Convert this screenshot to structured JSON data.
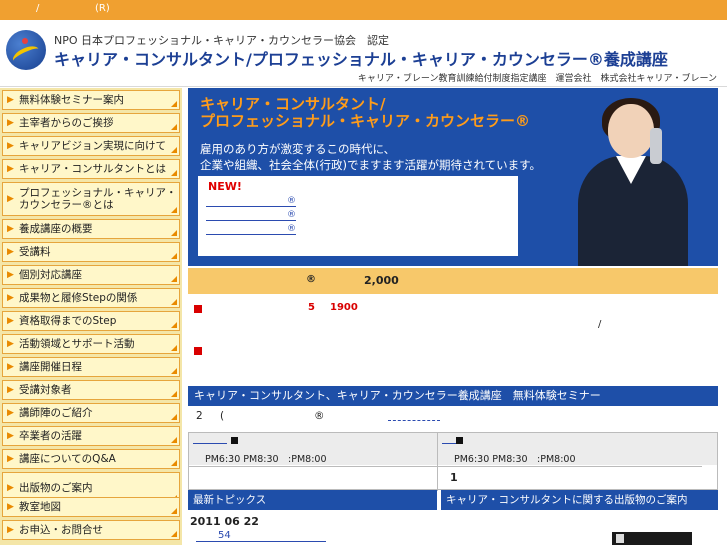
{
  "topbar": {
    "item1": "/",
    "item2": "(R)"
  },
  "header": {
    "assoc": "NPO 日本プロフェッショナル・キャリア・カウンセラー協会　認定",
    "title": "キャリア・コンサルタント/プロフェッショナル・キャリア・カウンセラー®養成講座",
    "provider": "キャリア・ブレーン教育訓練給付制度指定講座　運営会社　株式会社キャリア・ブレーン"
  },
  "sidebar": {
    "items": [
      {
        "label": "無料体験セミナー案内"
      },
      {
        "label": "主宰者からのご挨拶"
      },
      {
        "label": "キャリアビジョン実現に向けて"
      },
      {
        "label": "キャリア・コンサルタントとは"
      },
      {
        "label": "プロフェッショナル・キャリア・\nカウンセラー®とは"
      },
      {
        "label": "養成講座の概要"
      },
      {
        "label": "受講料"
      },
      {
        "label": "個別対応講座"
      },
      {
        "label": "成果物と履修Stepの関係"
      },
      {
        "label": "資格取得までのStep"
      },
      {
        "label": "活動領域とサポート活動"
      },
      {
        "label": "講座開催日程"
      },
      {
        "label": "受講対象者"
      },
      {
        "label": "講師陣のご紹介"
      },
      {
        "label": "卒業者の活躍"
      },
      {
        "label": "講座についてのQ&A"
      },
      {
        "label": "出版物のご案内"
      },
      {
        "label": "教室地図"
      },
      {
        "label": "お申込・お問合せ"
      }
    ]
  },
  "hero": {
    "title_line1": "キャリア・コンサルタント/",
    "title_line2": "プロフェッショナル・キャリア・カウンセラー®",
    "sub_line1": "雇用のあり方が激変するこの時代に、",
    "sub_line2": "企業や組織、社会全体(行政)でますます活躍が期待されています。",
    "new_badge": "NEW!",
    "links": [
      "®",
      "®",
      "®"
    ]
  },
  "price_band": {
    "mark": "®",
    "amount": "2,000"
  },
  "notice": {
    "num5": "5",
    "num1900": "1900",
    "slash": "/"
  },
  "seminar": {
    "bar_title": "キャリア・コンサルタント、キャリア・カウンセラー養成講座　無料体験セミナー",
    "count": "2",
    "paren": "(",
    "mark": "®"
  },
  "schedule": {
    "left_time": "PM6:30 PM8:30　:PM8:00",
    "right_time": "PM6:30 PM8:30　:PM8:00",
    "right_count": "1"
  },
  "topics": {
    "bar_title": "最新トピックス",
    "date": "2011 06 22",
    "link": "54"
  },
  "publications": {
    "bar_title": "キャリア・コンサルタントに関する出版物のご案内"
  }
}
